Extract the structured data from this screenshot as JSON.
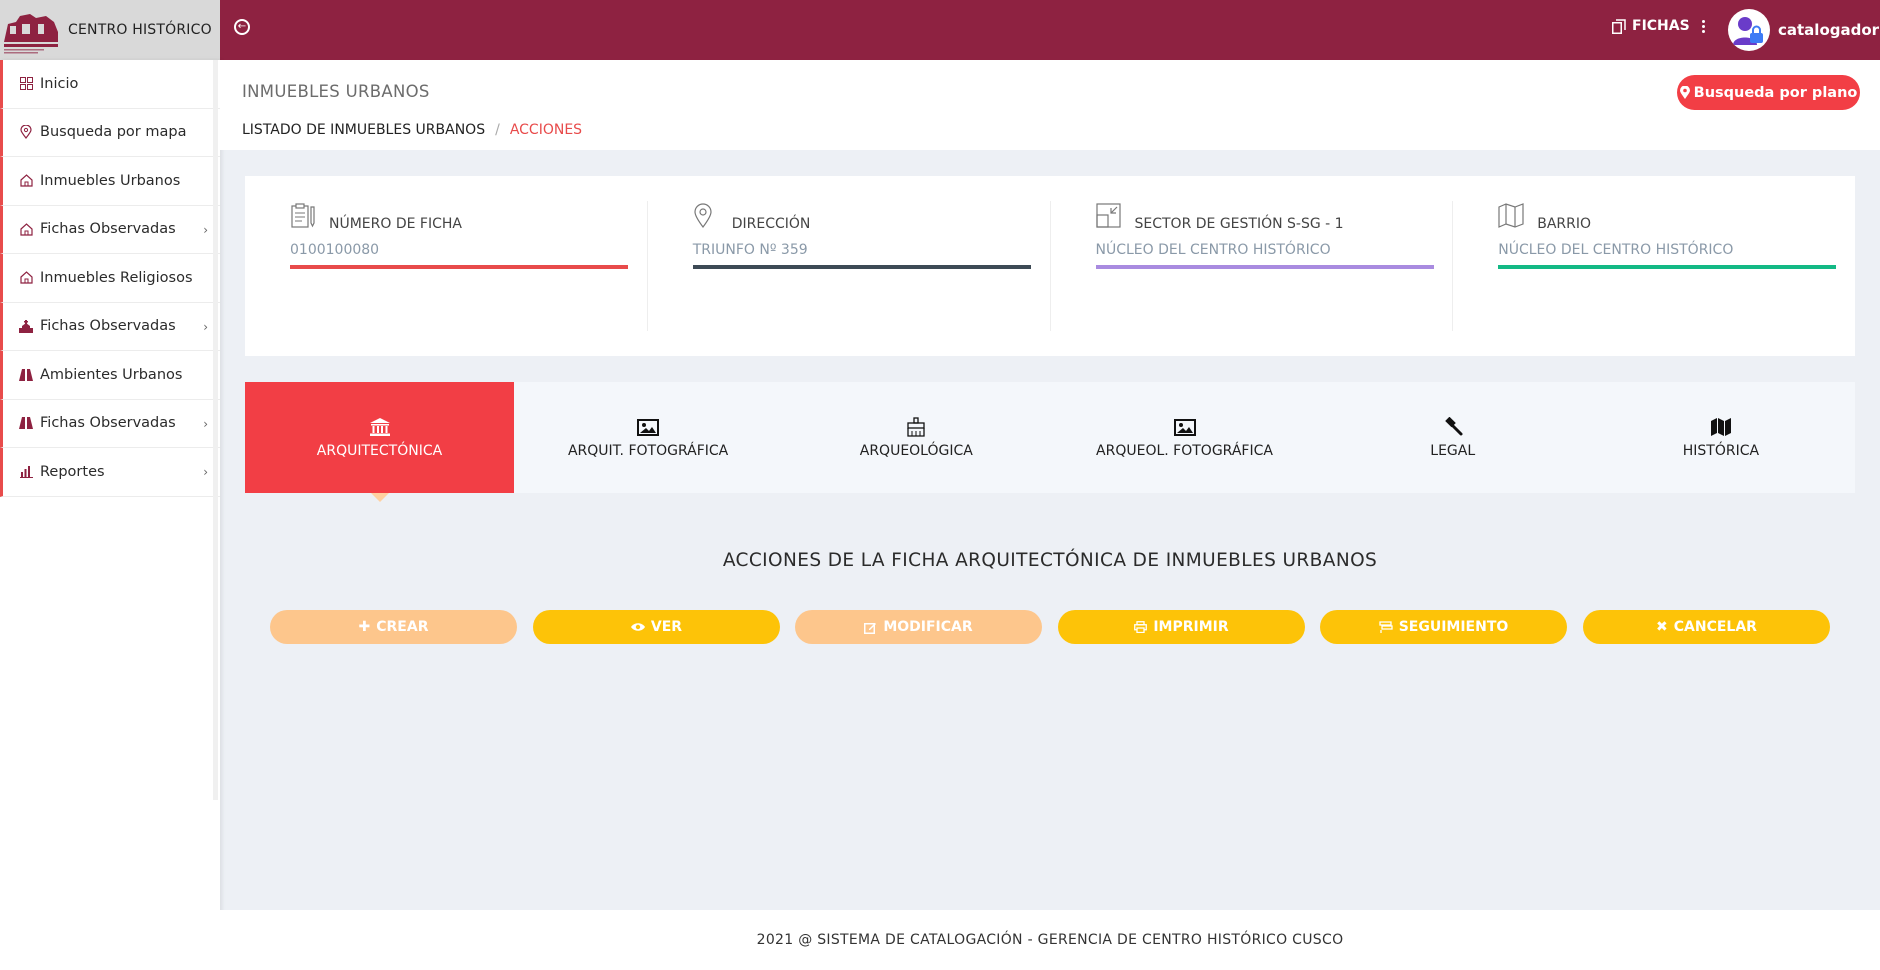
{
  "brand": {
    "name": "CENTRO HISTÓRICO",
    "logo": "centro-historico-logo"
  },
  "topbar": {
    "fichas_label": "FICHAS",
    "user_name": "catalogador"
  },
  "sidebar": {
    "items": [
      {
        "label": "Inicio",
        "icon": "grid-icon",
        "chevron": false
      },
      {
        "label": "Busqueda por mapa",
        "icon": "map-pin-icon",
        "chevron": false
      },
      {
        "label": "Inmuebles Urbanos",
        "icon": "home-icon",
        "chevron": false
      },
      {
        "label": "Fichas Observadas",
        "icon": "home-icon",
        "chevron": true
      },
      {
        "label": "Inmuebles Religiosos",
        "icon": "home-icon",
        "chevron": false
      },
      {
        "label": "Fichas Observadas",
        "icon": "church-icon",
        "chevron": true
      },
      {
        "label": "Ambientes Urbanos",
        "icon": "road-icon",
        "chevron": false
      },
      {
        "label": "Fichas Observadas",
        "icon": "road-icon",
        "chevron": true
      },
      {
        "label": "Reportes",
        "icon": "bar-chart-icon",
        "chevron": true
      }
    ]
  },
  "header": {
    "title": "INMUEBLES URBANOS",
    "breadcrumb": [
      "LISTADO DE INMUEBLES URBANOS",
      "ACCIONES"
    ],
    "plano_button": "Busqueda por plano"
  },
  "info": [
    {
      "label": "NÚMERO DE FICHA",
      "value": "0100100080",
      "color": "#e84b4b",
      "icon": "clipboard-icon"
    },
    {
      "label": "DIRECCIÓN",
      "value": "TRIUNFO Nº 359",
      "color": "#3d4a55",
      "icon": "location-icon"
    },
    {
      "label": "SECTOR DE GESTIÓN S-SG - 1",
      "value": "NÚCLEO DEL CENTRO HISTÓRICO",
      "color": "#a98be0",
      "icon": "shrink-icon"
    },
    {
      "label": "BARRIO",
      "value": "NÚCLEO DEL CENTRO HISTÓRICO",
      "color": "#13b985",
      "icon": "map-icon"
    }
  ],
  "tabs": [
    {
      "label": "ARQUITECTÓNICA",
      "icon": "building-columns-icon",
      "active": true
    },
    {
      "label": "ARQUIT. FOTOGRÁFICA",
      "icon": "image-icon",
      "active": false
    },
    {
      "label": "ARQUEOLÓGICA",
      "icon": "brush-icon",
      "active": false
    },
    {
      "label": "ARQUEOL. FOTOGRÁFICA",
      "icon": "image-icon",
      "active": false
    },
    {
      "label": "LEGAL",
      "icon": "gavel-icon",
      "active": false
    },
    {
      "label": "HISTÓRICA",
      "icon": "folded-map-icon",
      "active": false
    }
  ],
  "actions": {
    "title": "ACCIONES DE LA FICHA ARQUITECTÓNICA DE INMUEBLES URBANOS",
    "buttons": [
      {
        "label": "CREAR",
        "icon": "plus-icon",
        "enabled": false
      },
      {
        "label": "VER",
        "icon": "eye-icon",
        "enabled": true
      },
      {
        "label": "MODIFICAR",
        "icon": "edit-icon",
        "enabled": false
      },
      {
        "label": "IMPRIMIR",
        "icon": "print-icon",
        "enabled": true
      },
      {
        "label": "SEGUIMIENTO",
        "icon": "tracking-icon",
        "enabled": true
      },
      {
        "label": "CANCELAR",
        "icon": "close-icon",
        "enabled": true
      }
    ]
  },
  "footer": {
    "text": "2021 @ SISTEMA DE CATALOGACIÓN - GERENCIA DE CENTRO HISTÓRICO CUSCO"
  },
  "colors": {
    "primary": "#8e2241",
    "accent": "#f23e45",
    "button_enabled": "#fdc308",
    "button_disabled": "#fdc68c"
  }
}
